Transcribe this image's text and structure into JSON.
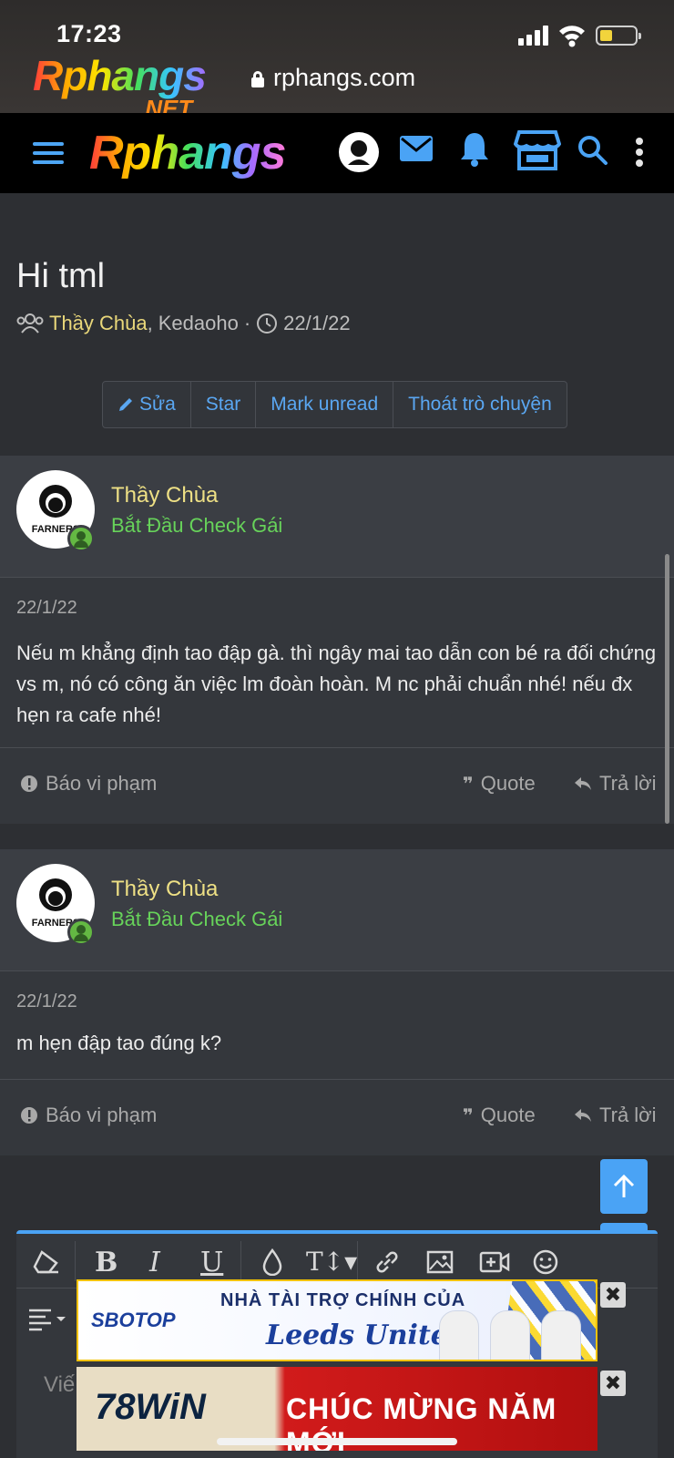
{
  "status": {
    "time": "17:23"
  },
  "browser": {
    "site_logo_main": "Rphangs",
    "site_logo_suffix": ".NET",
    "url": "rphangs.com"
  },
  "header": {
    "brand": "Rphangs"
  },
  "thread": {
    "title": "Hi tml",
    "starter": "Thầy Chùa",
    "participant_sep": ",",
    "participant": "Kedaoho",
    "dot": "·",
    "date": "22/1/22"
  },
  "actions": {
    "edit": "Sửa",
    "star": "Star",
    "mark_unread": "Mark unread",
    "leave": "Thoát trò chuyện"
  },
  "posts": [
    {
      "author": "Thầy Chùa",
      "rank": "Bắt Đầu Check Gái",
      "date": "22/1/22",
      "body": "Nếu m khẳng định tao đập gà. thì ngây mai tao dẫn con bé ra đối chứng vs m, nó có công ăn việc lm đoàn hoàn. M nc phải chuẩn nhé! nếu đx hẹn ra cafe nhé!",
      "report": "Báo vi phạm",
      "quote": "Quote",
      "reply": "Trả lời"
    },
    {
      "author": "Thầy Chùa",
      "rank": "Bắt Đầu Check Gái",
      "date": "22/1/22",
      "body": "m hẹn đập tao đúng k?",
      "report": "Báo vi phạm",
      "quote": "Quote",
      "reply": "Trả lời"
    }
  ],
  "avatar_text": "FARNERS",
  "editor": {
    "placeholder": "Viế"
  },
  "ads": {
    "ad1_logo": "SBOTOP",
    "ad1_line1": "NHÀ TÀI TRỢ CHÍNH CỦA",
    "ad1_line2": "Leeds United",
    "ad2_logo": "78WiN",
    "ad2_text": "CHÚC MỪNG NĂM MỚI",
    "close": "✖"
  },
  "colors": {
    "accent": "#4aa3f5",
    "username": "#eee085",
    "rank": "#67d35a",
    "background": "#2d2f33"
  }
}
